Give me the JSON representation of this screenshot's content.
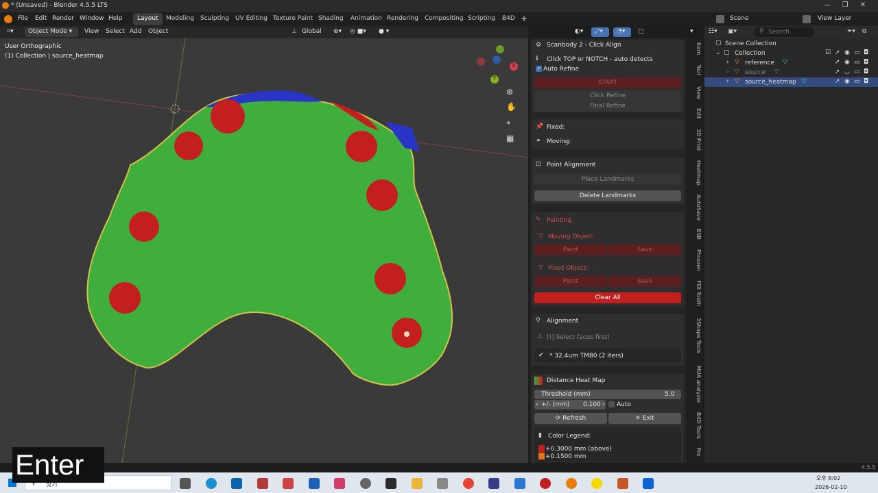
{
  "titlebar": {
    "title": "* (Unsaved) - Blender 4.5.5 LTS"
  },
  "menu": [
    "File",
    "Edit",
    "Render",
    "Window",
    "Help"
  ],
  "workspaces": [
    "Layout",
    "Modeling",
    "Sculpting",
    "UV Editing",
    "Texture Paint",
    "Shading",
    "Animation",
    "Rendering",
    "Compositing",
    "Scripting",
    "B4D"
  ],
  "scene": "Scene",
  "view_layer": "View Layer",
  "viewport_header": {
    "mode": "Object Mode",
    "view": "View",
    "select": "Select",
    "add": "Add",
    "object": "Object",
    "orientation": "Global"
  },
  "viewport": {
    "view_name": "User Orthographic",
    "collection_info": "(1) Collection | source_heatmap"
  },
  "panel_scanbody": {
    "title": "Scanbody 2 - Click Align",
    "hint": "Click TOP or NOTCH - auto detects",
    "auto_refine": "Auto Refine",
    "start": "START",
    "click_refine": "Click Refine",
    "final_refine": "Final Refine"
  },
  "panel_fixed": {
    "fixed": "Fixed:",
    "moving": "Moving:"
  },
  "panel_point": {
    "title": "Point Alignment",
    "place": "Place Landmarks",
    "delete": "Delete Landmarks"
  },
  "panel_painting": {
    "title": "Painting",
    "moving_obj": "Moving Object:",
    "fixed_obj": "Fixed Object:",
    "paint": "Paint",
    "save": "Save",
    "clear": "Clear All"
  },
  "panel_alignment": {
    "title": "Alignment",
    "select_first": "[!] Select faces first!",
    "result": "* 32.4um TM80 (2 iters)"
  },
  "panel_heatmap": {
    "title": "Distance Heat Map",
    "threshold_label": "Threshold (mm)",
    "threshold_value": "5.0",
    "pm_label": "+/- (mm)",
    "pm_value": "0.100",
    "auto": "Auto",
    "refresh": "Refresh",
    "exit": "Exit",
    "legend_title": "Color Legend:",
    "legend_1": "+0.3000 mm (above)",
    "legend_2": "+0.1500 mm"
  },
  "vtabs": [
    "Item",
    "Tool",
    "View",
    "Edit",
    "3D Print",
    "Heatmap",
    "AutoSave",
    "BSB",
    "Phrozen",
    "FDI Tooth",
    "3Shape Tools",
    "MUA analyzer",
    "B4D Tools",
    "Pro"
  ],
  "outliner": {
    "root": "Scene Collection",
    "collection": "Collection",
    "items": [
      "reference",
      "source",
      "source_heatmap"
    ],
    "search_placeholder": "Search"
  },
  "status": {
    "version": "4.5.5"
  },
  "taskbar": {
    "search": "찾기",
    "time": "오후 8:02",
    "date": "2026-02-10"
  },
  "overlay_text": "Enter",
  "colors": {
    "accent": "#334d80",
    "heat_green": "#3fae3c",
    "heat_red": "#c41f1f",
    "button_red": "#c41f1f"
  }
}
